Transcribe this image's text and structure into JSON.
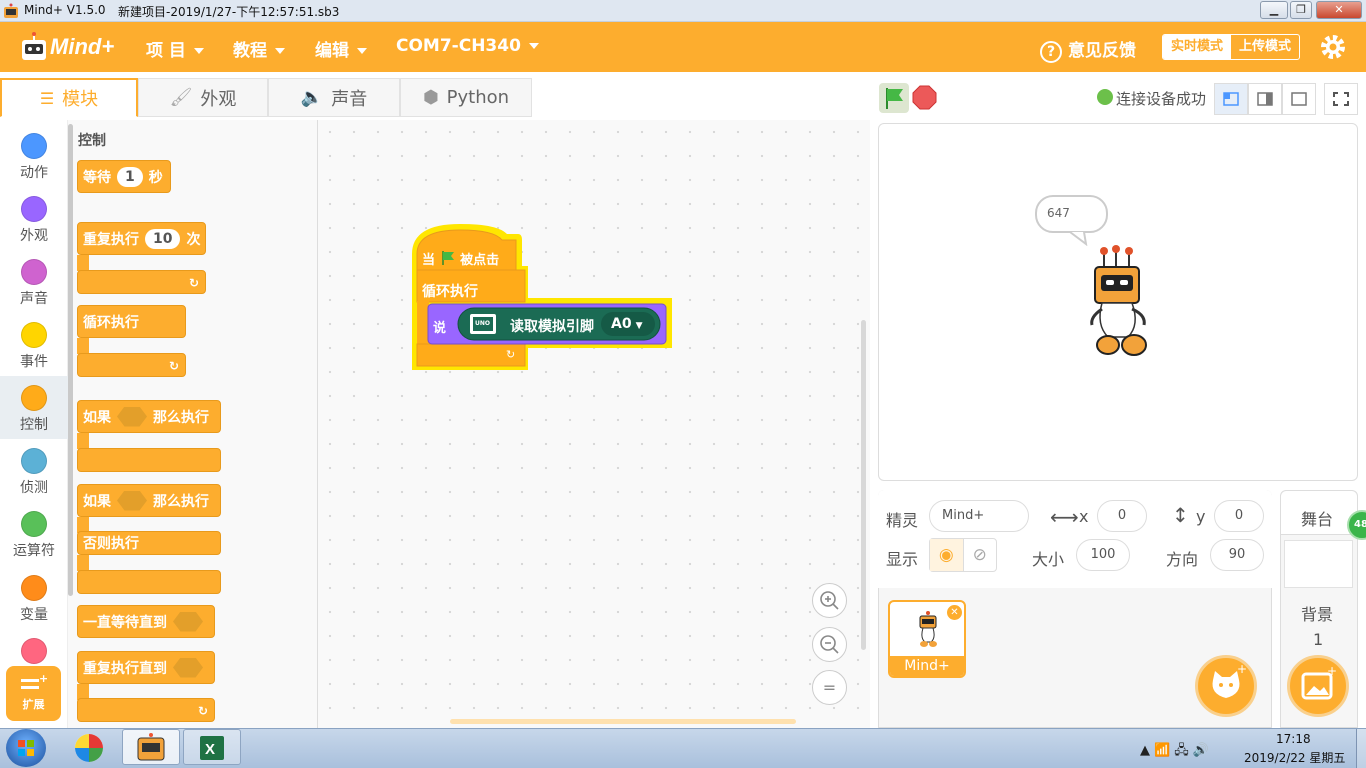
{
  "window": {
    "title": "Mind+ V1.5.0",
    "file": "新建项目-2019/1/27-下午12:57:51.sb3"
  },
  "menu": {
    "project": "项 目",
    "tutorial": "教程",
    "edit": "编辑",
    "port": "COM7-CH340",
    "feedback": "意见反馈",
    "realtime_mode": "实时模式",
    "upload_mode": "上传模式"
  },
  "tabs": [
    {
      "label": "模块"
    },
    {
      "label": "外观"
    },
    {
      "label": "声音"
    },
    {
      "label": "Python"
    }
  ],
  "stage_toolbar": {
    "status": "连接设备成功"
  },
  "categories": [
    {
      "label": "动作",
      "color": "#4c97ff"
    },
    {
      "label": "外观",
      "color": "#9966ff"
    },
    {
      "label": "声音",
      "color": "#cf63cf"
    },
    {
      "label": "事件",
      "color": "#ffd500"
    },
    {
      "label": "控制",
      "color": "#ffab19"
    },
    {
      "label": "侦测",
      "color": "#5cb1d6"
    },
    {
      "label": "运算符",
      "color": "#59c059"
    },
    {
      "label": "变量",
      "color": "#ff8c1a"
    },
    {
      "label": "",
      "color": "#ff6680"
    }
  ],
  "extension_label": "扩展",
  "palette": {
    "heading": "控制",
    "wait": {
      "a": "等待",
      "value": "1",
      "b": "秒"
    },
    "repeat": {
      "a": "重复执行",
      "value": "10",
      "b": "次"
    },
    "forever": "循环执行",
    "if_then": {
      "a": "如果",
      "b": "那么执行"
    },
    "if_else": {
      "a": "如果",
      "b": "那么执行",
      "c": "否则执行"
    },
    "wait_until": "一直等待直到",
    "repeat_until": "重复执行直到"
  },
  "script": {
    "hat": {
      "a": "当",
      "b": "被点击"
    },
    "forever": "循环执行",
    "say": "说",
    "read_pin": "读取模拟引脚",
    "pin": "A0",
    "board": "UNO"
  },
  "stage": {
    "speech": "647"
  },
  "sprite_info": {
    "sprite_label": "精灵",
    "sprite_name": "Mind+",
    "x_label": "x",
    "x": "0",
    "y_label": "y",
    "y": "0",
    "show_label": "显示",
    "size_label": "大小",
    "size": "100",
    "direction_label": "方向",
    "direction": "90"
  },
  "sprite_card": {
    "name": "Mind+"
  },
  "stage_panel": {
    "title": "舞台",
    "backdrop_label": "背景",
    "backdrop_count": "1",
    "badge": "48"
  },
  "taskbar": {
    "time": "17:18",
    "date": "2019/2/22 星期五"
  }
}
